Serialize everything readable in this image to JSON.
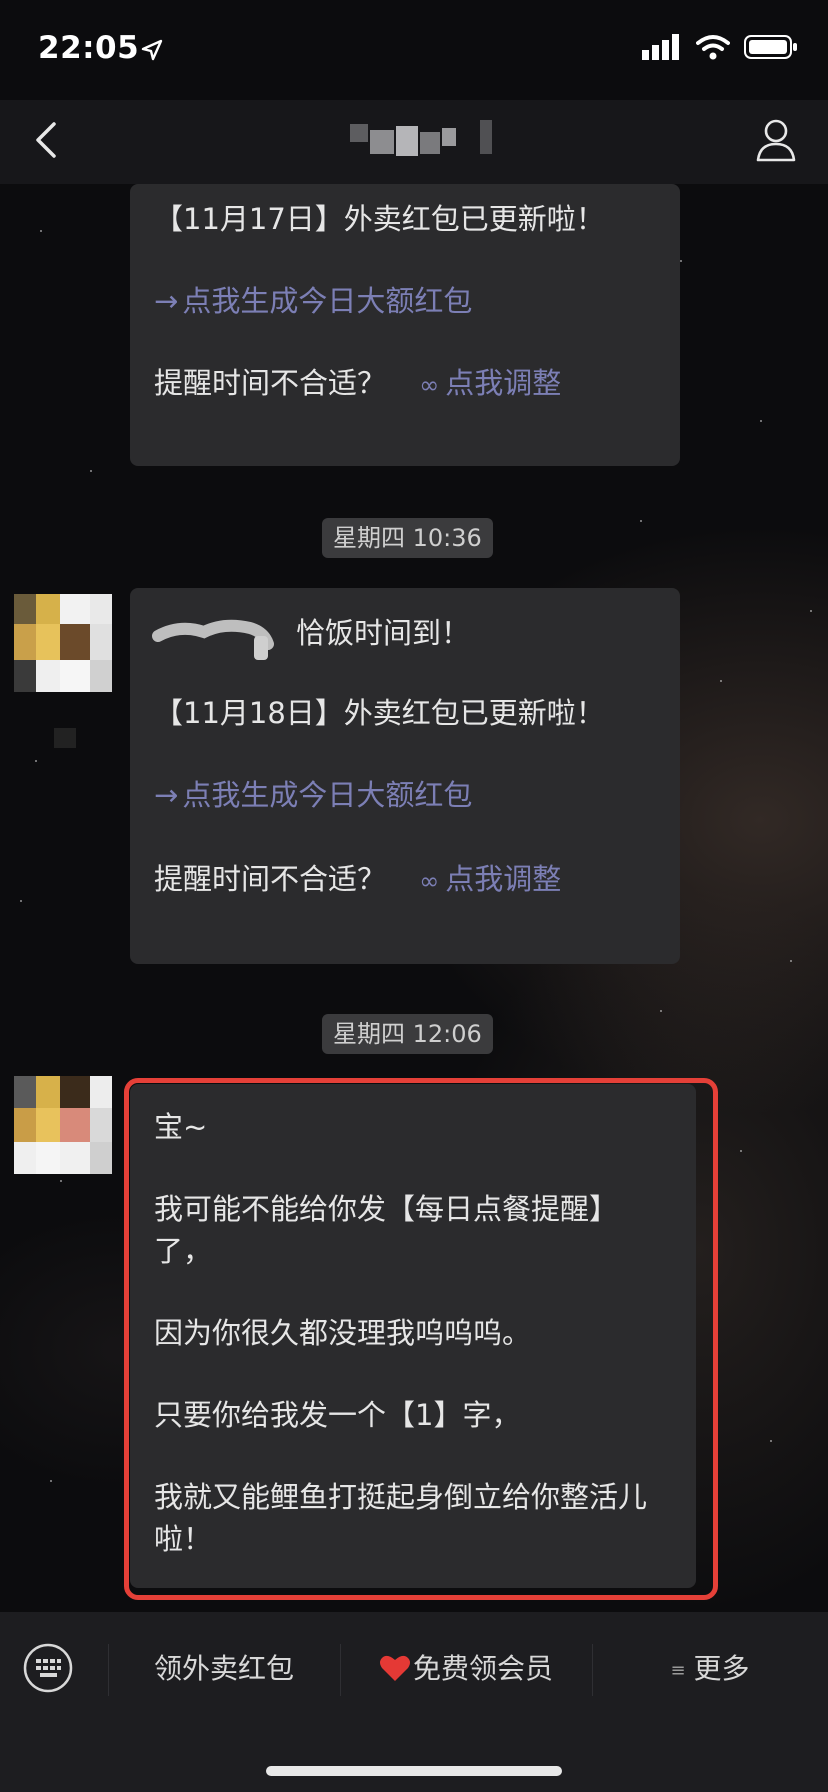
{
  "status_bar": {
    "time": "22:05"
  },
  "nav": {
    "back_icon": "chevron-left-icon",
    "profile_icon": "user-icon"
  },
  "messages": [
    {
      "date_line": "【11月17日】外卖红包已更新啦！",
      "link_label": "点我生成今日大额红包",
      "reminder_question": "提醒时间不合适？",
      "adjust_label": "点我调整"
    },
    {
      "timestamp": "星期四 10:36",
      "greeting": "恰饭时间到！",
      "date_line": "【11月18日】外卖红包已更新啦！",
      "link_label": "点我生成今日大额红包",
      "reminder_question": "提醒时间不合适？",
      "adjust_label": "点我调整"
    },
    {
      "timestamp": "星期四 12:06",
      "line1": "宝~",
      "line2": "我可能不能给你发【每日点餐提醒】了，",
      "line3": "因为你很久都没理我呜呜呜。",
      "line4": "只要你给我发一个【1】字，",
      "line5": "我就又能鲤鱼打挺起身倒立给你整活儿啦！"
    }
  ],
  "bottom_menu": {
    "item1": "领外卖红包",
    "item2_icon": "heart-icon",
    "item2": "免费领会员",
    "item3_icon": "menu-lines-icon",
    "item3": "更多"
  },
  "colors": {
    "accent_link": "#7c7fb5",
    "highlight_border": "#e54038",
    "bubble": "#2b2b2d"
  }
}
